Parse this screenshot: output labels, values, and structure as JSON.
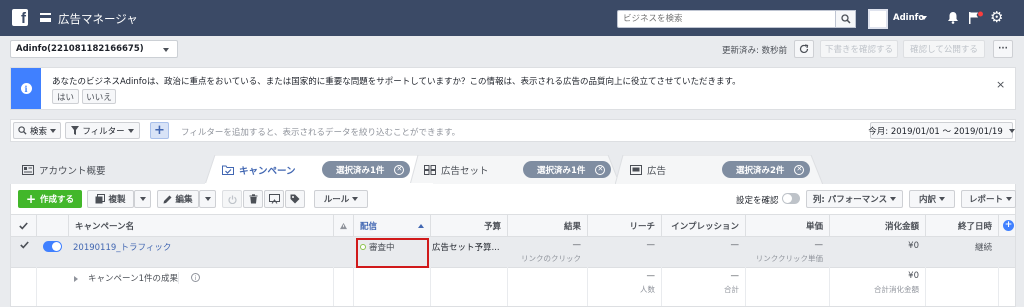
{
  "app": {
    "title": "広告マネージャ",
    "logo": "f"
  },
  "search": {
    "placeholder": "ビジネスを検索"
  },
  "account_menu": {
    "name": "Adinfo"
  },
  "account_selector": {
    "value": "Adinfo(221081182166675)"
  },
  "status_bar": {
    "updated": "更新済み: 数秒前",
    "review_draft": "下書きを確認する",
    "review_publish": "確認して公開する",
    "more": "···"
  },
  "notice": {
    "text": "あなたのビジネスAdinfoは、政治に重点をおいている、または国家的に重要な問題をサポートしていますか？この情報は、表示される広告の品質向上に役立てさせていただきます。",
    "yes": "はい",
    "no": "いいえ",
    "close": "×"
  },
  "filter_bar": {
    "search_label": "検索",
    "filter_label": "フィルター",
    "add": "+",
    "hint": "フィルターを追加すると、表示されるデータを絞り込むことができます。",
    "date_range": "今月: 2019/01/01 ～ 2019/01/19"
  },
  "tabs": [
    {
      "label": "アカウント概要"
    },
    {
      "label": "キャンペーン",
      "pill": "選択済み1件",
      "active": true
    },
    {
      "label": "広告セット",
      "pill": "選択済み1件"
    },
    {
      "label": "広告",
      "pill": "選択済み2件"
    }
  ],
  "toolbar": {
    "create": "作成する",
    "duplicate": "複製",
    "edit": "編集",
    "rules": "ルール",
    "view_settings": "設定を確認",
    "columns": "列: パフォーマンス",
    "breakdown": "内訳",
    "reports": "レポート"
  },
  "table": {
    "headers": {
      "campaign": "キャンペーン名",
      "delivery": "配信",
      "budget": "予算",
      "results": "結果",
      "reach": "リーチ",
      "impressions": "インプレッション",
      "cost": "単価",
      "spent": "消化金額",
      "end": "終了日時"
    },
    "row": {
      "name": "20190119_トラフィック",
      "delivery": "審査中",
      "budget": "広告セット予算...",
      "results": "—",
      "results_sub": "リンクのクリック",
      "reach": "—",
      "impressions": "—",
      "cost": "—",
      "cost_sub": "リンククリック単価",
      "spent": "¥0",
      "end": "継続"
    },
    "summary": {
      "label": "キャンペーン1件の成果",
      "reach": "—",
      "reach_sub": "人数",
      "impressions": "—",
      "impressions_sub": "合計",
      "spent": "¥0",
      "spent_sub": "合計消化金額"
    }
  },
  "colors": {
    "topbar": "#3b4a66",
    "accent": "#4080ff",
    "create": "#42b72a",
    "highlight": "#d0191a"
  }
}
